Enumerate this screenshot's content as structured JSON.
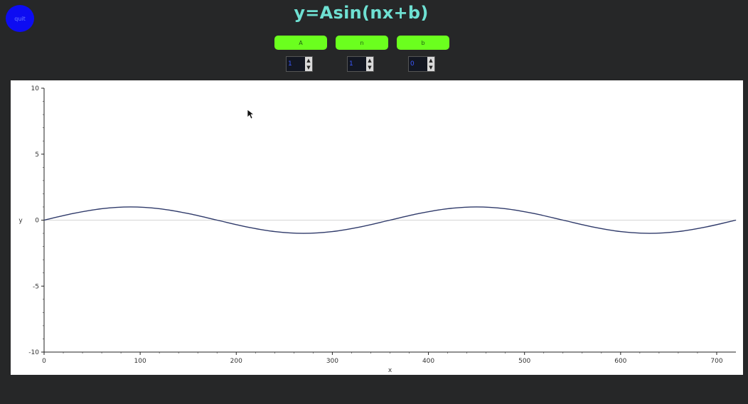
{
  "app": {
    "title": "y=Asin(nx+b)",
    "corner_button_label": "quit"
  },
  "controls": [
    {
      "label": "A",
      "value": "1"
    },
    {
      "label": "n",
      "value": "1"
    },
    {
      "label": "b",
      "value": "0"
    }
  ],
  "colors": {
    "background": "#262728",
    "title": "#6ee0d2",
    "button": "#6bff1e",
    "corner_button": "#0d0cf2",
    "curve": "#2f3a6a"
  },
  "chart_data": {
    "type": "line",
    "title": "",
    "xlabel": "x",
    "ylabel": "y",
    "xlim": [
      0,
      720
    ],
    "ylim": [
      -10,
      10
    ],
    "xticks": [
      0,
      100,
      200,
      300,
      400,
      500,
      600,
      700
    ],
    "yticks": [
      -10,
      -5,
      0,
      5,
      10
    ],
    "grid": false,
    "series": [
      {
        "x": [
          0,
          30,
          60,
          90,
          120,
          150,
          180,
          210,
          240,
          270,
          300,
          330,
          360,
          390,
          420,
          450,
          480,
          510,
          540,
          570,
          600,
          630,
          660,
          690,
          720
        ],
        "y": [
          0,
          0.5,
          0.866,
          1,
          0.866,
          0.5,
          0,
          -0.5,
          -0.866,
          -1,
          -0.866,
          -0.5,
          0,
          0.5,
          0.866,
          1,
          0.866,
          0.5,
          0,
          -0.5,
          -0.866,
          -1,
          -0.866,
          -0.5,
          0
        ]
      }
    ]
  }
}
